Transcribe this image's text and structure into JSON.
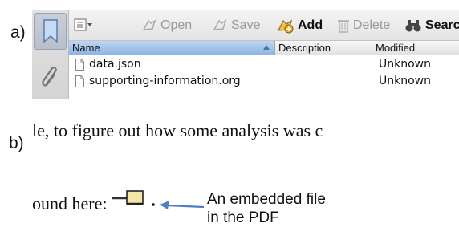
{
  "labels": {
    "a": "a)",
    "b": "b)"
  },
  "sidebar": {
    "tabs": [
      {
        "icon": "bookmark-icon",
        "selected": true
      },
      {
        "icon": "paperclip-icon",
        "selected": false
      }
    ]
  },
  "toolbar": {
    "menu_icon": "list-view-icon",
    "items": [
      {
        "label": "Open",
        "icon": "open-icon",
        "enabled": false
      },
      {
        "label": "Save",
        "icon": "save-icon",
        "enabled": false
      },
      {
        "label": "Add",
        "icon": "add-attachment-icon",
        "enabled": true
      },
      {
        "label": "Delete",
        "icon": "trash-icon",
        "enabled": false
      },
      {
        "label": "Search",
        "icon": "binoculars-icon",
        "enabled": true
      }
    ]
  },
  "table": {
    "columns": [
      "Name",
      "Description",
      "Modified"
    ],
    "sorted_column": "Name",
    "rows": [
      {
        "name": "data.json",
        "description": "",
        "modified": "Unknown"
      },
      {
        "name": "supporting-information.org",
        "description": "",
        "modified": "Unknown"
      }
    ]
  },
  "document": {
    "line1": "le, to figure out how some analysis was c",
    "line2": "ound here:",
    "line2_suffix": "."
  },
  "callout": {
    "line1": "An embedded file",
    "line2": "in the PDF"
  },
  "colors": {
    "selected_header": "#8fb4e2",
    "arrow": "#4f7fc0",
    "attachment_icon": "#f3e7a8"
  }
}
